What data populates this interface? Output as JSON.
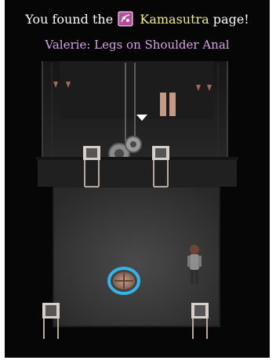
{
  "banner": {
    "prefix": "You found the",
    "item": "Kamasutra",
    "suffix": "page!"
  },
  "subtitle": "Valerie: Legs on Shoulder Anal",
  "icons": {
    "item": "kamasutra-book-icon",
    "target": "white-triangle-marker-icon"
  },
  "colors": {
    "background": "#060606",
    "banner_text": "#ffffff",
    "item_highlight": "#f4f07a",
    "subtitle_text": "#d9a4e8",
    "teleport_ring": "#35b4e8"
  }
}
